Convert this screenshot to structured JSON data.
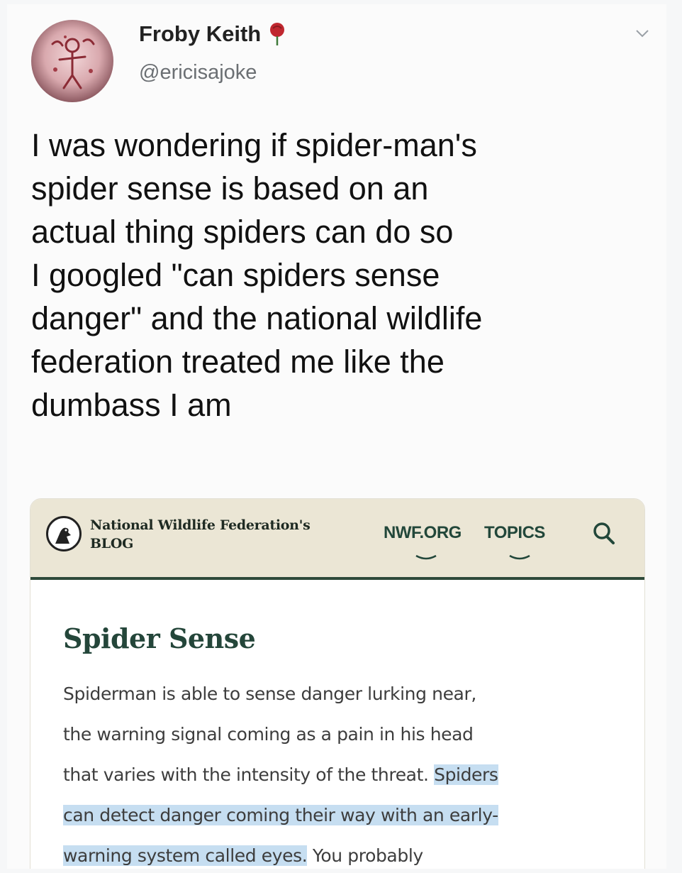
{
  "tweet": {
    "author_name": "Froby Keith",
    "author_handle": "@ericisajoke",
    "text_lines": [
      "I was wondering if spider-man's",
      "spider sense is based on an",
      "actual thing spiders can do so",
      "I googled \"can spiders sense",
      "danger\" and the national wildlife",
      "federation treated me like the",
      "dumbass I am"
    ],
    "icons": {
      "name_badge": "rose-icon",
      "menu": "chevron-down-icon"
    }
  },
  "screenshot": {
    "header": {
      "blog_title_line1": "National Wildlife Federation's",
      "blog_title_line2": "BLOG",
      "nav_items": [
        "NWF.ORG",
        "TOPICS"
      ],
      "search_icon": "search-icon",
      "logo_icon": "nwf-logo-icon"
    },
    "article": {
      "title": "Spider Sense",
      "lines": [
        {
          "plain": "Spiderman is able to sense danger lurking near,",
          "highlight": ""
        },
        {
          "plain": "the warning signal coming as a pain in his head",
          "highlight": ""
        },
        {
          "plain": "that varies with the intensity of the threat. ",
          "highlight": "Spiders"
        },
        {
          "plain": "",
          "highlight": "can detect danger coming their way with an early-"
        },
        {
          "highlight": "warning system called eyes.",
          "plain": " You probably"
        }
      ]
    },
    "colors": {
      "header_bg": "#ebe6d5",
      "brand_green": "#24463a",
      "highlight": "#c6def1"
    }
  }
}
